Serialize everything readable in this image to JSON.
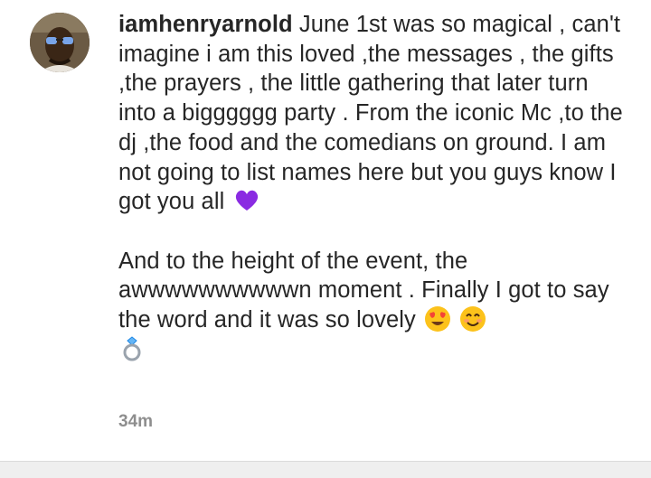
{
  "comment": {
    "username": "iamhenryarnold",
    "paragraph1": " June 1st was so magical , can't imagine i am this loved ,the messages , the gifts ,the prayers , the little gathering  that later turn into a bigggggg party . From the iconic Mc ,to the dj ,the food and the comedians on ground.  I am not going to list names here but you guys know I got you all ",
    "paragraph2": "And to the height of the event, the awwwwwwwwwwn moment . Finally I got to say the word and it was so lovely ",
    "timestamp": "34m",
    "emojis": [
      "purple-heart-icon",
      "heart-eyes-face-icon",
      "smiling-face-icon",
      "ring-icon"
    ]
  },
  "colors": {
    "text": "#262626",
    "meta": "#8e8e8e",
    "purple_heart": "#8a2be2",
    "emoji_yellow": "#fcc21b"
  }
}
